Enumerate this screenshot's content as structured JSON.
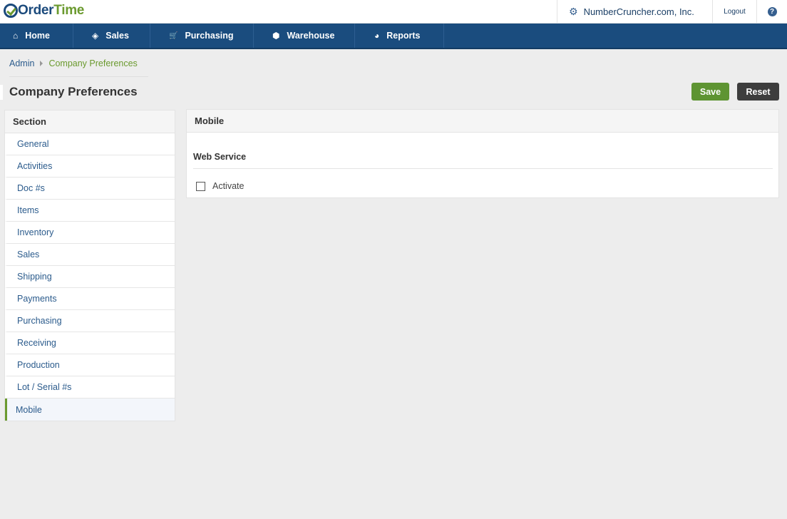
{
  "app": {
    "logo_order": "Order",
    "logo_time": "Time"
  },
  "topbar": {
    "company": "NumberCruncher.com, Inc.",
    "logout": "Logout",
    "help": "?"
  },
  "nav": {
    "items": [
      {
        "label": "Home",
        "icon": "home-icon",
        "glyph": "⌂"
      },
      {
        "label": "Sales",
        "icon": "tag-icon",
        "glyph": "◈"
      },
      {
        "label": "Purchasing",
        "icon": "cart-icon",
        "glyph": "🛒"
      },
      {
        "label": "Warehouse",
        "icon": "box-icon",
        "glyph": "⬢"
      },
      {
        "label": "Reports",
        "icon": "pie-chart-icon",
        "glyph": "◕"
      }
    ]
  },
  "breadcrumb": {
    "admin": "Admin",
    "current": "Company Preferences"
  },
  "page": {
    "title": "Company Preferences",
    "save_label": "Save",
    "reset_label": "Reset"
  },
  "sections": {
    "header": "Section",
    "items": [
      {
        "label": "General"
      },
      {
        "label": "Activities"
      },
      {
        "label": "Doc #s"
      },
      {
        "label": "Items"
      },
      {
        "label": "Inventory"
      },
      {
        "label": "Sales"
      },
      {
        "label": "Shipping"
      },
      {
        "label": "Payments"
      },
      {
        "label": "Purchasing"
      },
      {
        "label": "Receiving"
      },
      {
        "label": "Production"
      },
      {
        "label": "Lot / Serial #s"
      },
      {
        "label": "Mobile",
        "active": true
      }
    ]
  },
  "content": {
    "header": "Mobile",
    "group_title": "Web Service",
    "activate_label": "Activate",
    "activate_checked": false
  },
  "colors": {
    "nav_bg": "#1a4c7e",
    "accent_green": "#5e9432",
    "link_blue": "#2b5b8c",
    "reset_bg": "#3d3d3d"
  }
}
